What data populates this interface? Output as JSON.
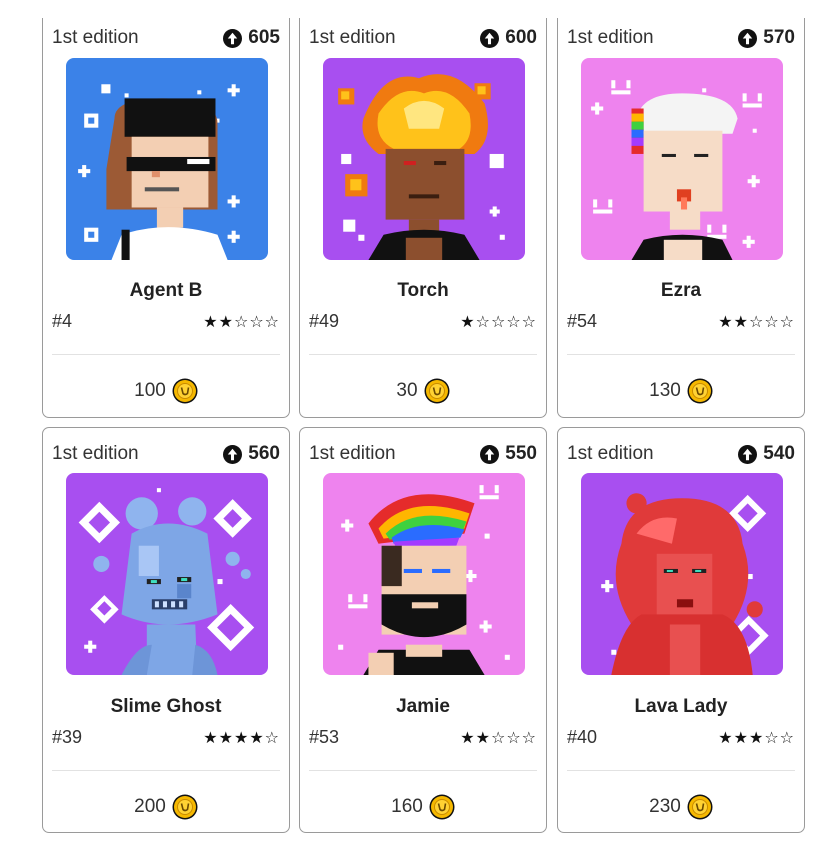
{
  "colors": {
    "blue_bg": "#3b82e8",
    "purple_bg": "#a84ff0",
    "pink_bg": "#ee83ee",
    "coin": "#f5b800"
  },
  "cards": [
    {
      "edition": "1st edition",
      "score": "605",
      "name": "Agent B",
      "number": "#4",
      "stars": "★★☆☆☆",
      "rating": 2,
      "price": "100",
      "bg": "blue"
    },
    {
      "edition": "1st edition",
      "score": "600",
      "name": "Torch",
      "number": "#49",
      "stars": "★☆☆☆☆",
      "rating": 1,
      "price": "30",
      "bg": "purple"
    },
    {
      "edition": "1st edition",
      "score": "570",
      "name": "Ezra",
      "number": "#54",
      "stars": "★★☆☆☆",
      "rating": 2,
      "price": "130",
      "bg": "pink"
    },
    {
      "edition": "1st edition",
      "score": "560",
      "name": "Slime Ghost",
      "number": "#39",
      "stars": "★★★★☆",
      "rating": 4,
      "price": "200",
      "bg": "purple"
    },
    {
      "edition": "1st edition",
      "score": "550",
      "name": "Jamie",
      "number": "#53",
      "stars": "★★☆☆☆",
      "rating": 2,
      "price": "160",
      "bg": "pink"
    },
    {
      "edition": "1st edition",
      "score": "540",
      "name": "Lava Lady",
      "number": "#40",
      "stars": "★★★☆☆",
      "rating": 3,
      "price": "230",
      "bg": "purple"
    }
  ],
  "icons": {
    "score": "arrow-up-circle-icon",
    "price": "coin-icon"
  }
}
